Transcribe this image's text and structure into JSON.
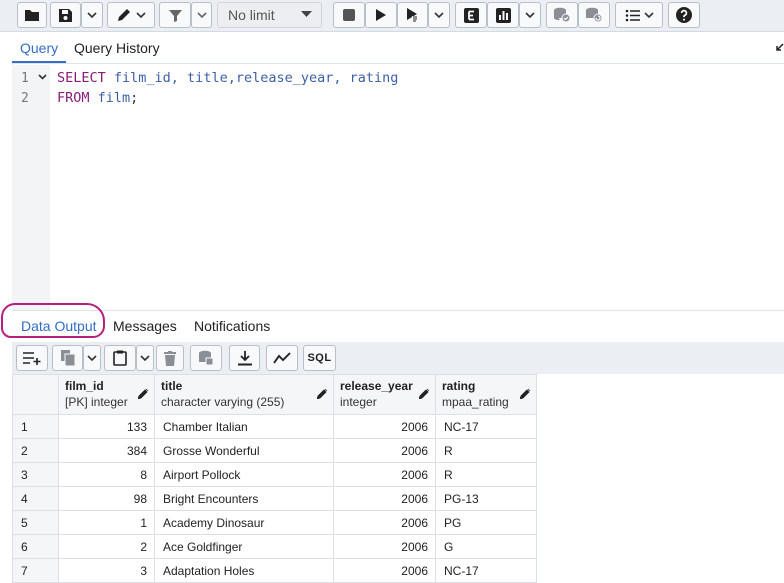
{
  "toolbar": {
    "limit_select": {
      "value": "No limit"
    },
    "buttons": [
      {
        "name": "open-file-button",
        "icon": "folder-icon"
      },
      {
        "name": "save-button",
        "icon": "save-icon"
      },
      {
        "name": "edit-button",
        "icon": "pencil-icon"
      },
      {
        "name": "filter-button",
        "icon": "filter-icon"
      },
      {
        "name": "stop-button",
        "icon": "stop-icon"
      },
      {
        "name": "execute-button",
        "icon": "play-icon"
      },
      {
        "name": "execute-script-button",
        "icon": "play-script-icon"
      },
      {
        "name": "explain-button",
        "icon": "explain-icon",
        "label": "E"
      },
      {
        "name": "explain-analyze-button",
        "icon": "bar-chart-icon"
      },
      {
        "name": "commit-button",
        "icon": "commit-icon"
      },
      {
        "name": "rollback-button",
        "icon": "rollback-icon"
      },
      {
        "name": "macros-button",
        "icon": "list-icon"
      },
      {
        "name": "help-button",
        "icon": "help-icon",
        "label": "?"
      }
    ]
  },
  "editor_tabs": [
    {
      "label": "Query",
      "active": true
    },
    {
      "label": "Query History",
      "active": false
    }
  ],
  "editor": {
    "lines": [
      {
        "number": "1",
        "tokens": [
          {
            "text": "SELECT",
            "kind": "keyword"
          },
          {
            "text": " film_id, title,release_year, rating",
            "kind": "identifier"
          }
        ]
      },
      {
        "number": "2",
        "tokens": [
          {
            "text": "FROM",
            "kind": "keyword"
          },
          {
            "text": " film",
            "kind": "identifier"
          },
          {
            "text": ";",
            "kind": "punct"
          }
        ]
      }
    ]
  },
  "output_tabs": [
    {
      "label": "Data Output",
      "active": true
    },
    {
      "label": "Messages",
      "active": false
    },
    {
      "label": "Notifications",
      "active": false
    }
  ],
  "output_toolbar": {
    "sql_label": "SQL",
    "buttons": [
      {
        "name": "add-row-button",
        "icon": "add-row-icon"
      },
      {
        "name": "copy-button",
        "icon": "copy-icon"
      },
      {
        "name": "paste-button",
        "icon": "paste-icon"
      },
      {
        "name": "delete-button",
        "icon": "trash-icon"
      },
      {
        "name": "save-data-button",
        "icon": "database-save-icon"
      },
      {
        "name": "download-button",
        "icon": "download-icon"
      },
      {
        "name": "graph-button",
        "icon": "line-chart-icon"
      },
      {
        "name": "sql-button",
        "icon": "sql-icon"
      }
    ]
  },
  "grid": {
    "columns": [
      {
        "name": "film_id",
        "type": "[PK] integer"
      },
      {
        "name": "title",
        "type": "character varying (255)"
      },
      {
        "name": "release_year",
        "type": "integer"
      },
      {
        "name": "rating",
        "type": "mpaa_rating"
      }
    ],
    "rows": [
      {
        "row": "1",
        "film_id": "133",
        "title": "Chamber Italian",
        "release_year": "2006",
        "rating": "NC-17"
      },
      {
        "row": "2",
        "film_id": "384",
        "title": "Grosse Wonderful",
        "release_year": "2006",
        "rating": "R"
      },
      {
        "row": "3",
        "film_id": "8",
        "title": "Airport Pollock",
        "release_year": "2006",
        "rating": "R"
      },
      {
        "row": "4",
        "film_id": "98",
        "title": "Bright Encounters",
        "release_year": "2006",
        "rating": "PG-13"
      },
      {
        "row": "5",
        "film_id": "1",
        "title": "Academy Dinosaur",
        "release_year": "2006",
        "rating": "PG"
      },
      {
        "row": "6",
        "film_id": "2",
        "title": "Ace Goldfinger",
        "release_year": "2006",
        "rating": "G"
      },
      {
        "row": "7",
        "film_id": "3",
        "title": "Adaptation Holes",
        "release_year": "2006",
        "rating": "NC-17"
      }
    ]
  },
  "colors": {
    "accent": "#326ec7",
    "annotation": "#b71f7e",
    "keyword": "#8b1b7a",
    "identifier": "#3d5fa8"
  }
}
